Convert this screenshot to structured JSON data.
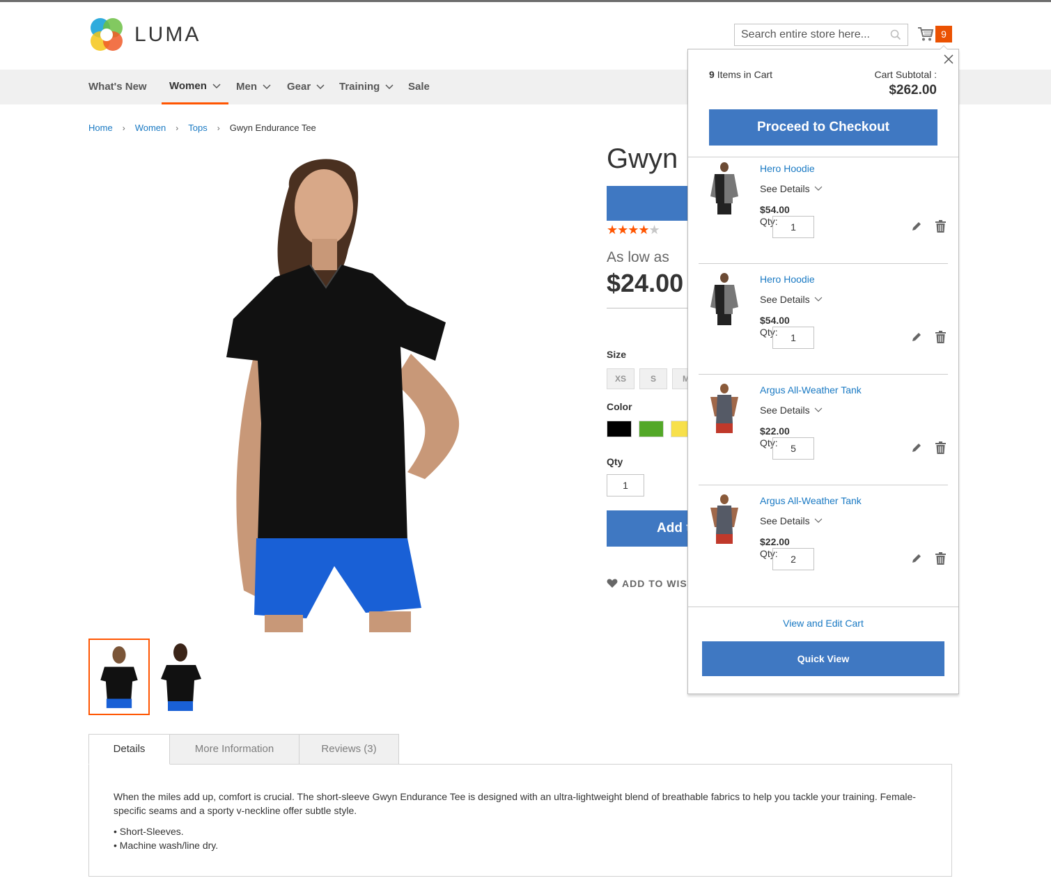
{
  "header": {
    "brand": "LUMA",
    "search_placeholder": "Search entire store here...",
    "cart_count": "9"
  },
  "nav": {
    "items": [
      {
        "label": "What's New"
      },
      {
        "label": "Women"
      },
      {
        "label": "Men"
      },
      {
        "label": "Gear"
      },
      {
        "label": "Training"
      },
      {
        "label": "Sale"
      }
    ],
    "active": "Women"
  },
  "breadcrumbs": [
    "Home",
    "Women",
    "Tops",
    "Gwyn Endurance Tee"
  ],
  "product": {
    "name": "Gwyn Endurance Tee",
    "rating": 4.5,
    "rating_max": 5,
    "price_label": "As low as",
    "price": "$24.00",
    "size_label": "Size",
    "sizes": [
      "XS",
      "S",
      "M"
    ],
    "color_label": "Color",
    "colors": [
      "#000000",
      "#53a828",
      "#f7e04b"
    ],
    "qty_label": "Qty",
    "qty": "1",
    "add_to_cart": "Add to Cart",
    "wishlist": "ADD TO WISH LIST"
  },
  "tabs": {
    "items": [
      "Details",
      "More Information",
      "Reviews (3)"
    ],
    "active": "Details",
    "details_text": "When the miles add up, comfort is crucial. The short-sleeve Gwyn Endurance Tee is designed with an ultra-lightweight blend of breathable fabrics to help you tackle your training. Female-specific seams and a sporty v-neckline offer subtle style.",
    "bullets": [
      "Short-Sleeves.",
      "Machine wash/line dry."
    ]
  },
  "minicart": {
    "count": "9",
    "count_label": "Items in Cart",
    "subtotal_label": "Cart Subtotal :",
    "subtotal": "$262.00",
    "checkout": "Proceed to Checkout",
    "see_details": "See Details",
    "qty_label": "Qty:",
    "items": [
      {
        "name": "Hero Hoodie",
        "price": "$54.00",
        "qty": "1",
        "image": "hoodie"
      },
      {
        "name": "Hero Hoodie",
        "price": "$54.00",
        "qty": "1",
        "image": "hoodie"
      },
      {
        "name": "Argus All-Weather Tank",
        "price": "$22.00",
        "qty": "5",
        "image": "tank"
      },
      {
        "name": "Argus All-Weather Tank",
        "price": "$22.00",
        "qty": "2",
        "image": "tank"
      }
    ],
    "view_edit": "View and Edit Cart",
    "quick_view": "Quick View"
  },
  "colors": {
    "primary_button": "#3f78c2",
    "link": "#1979c3",
    "accent": "#ff5501",
    "badge": "#eb5202"
  }
}
